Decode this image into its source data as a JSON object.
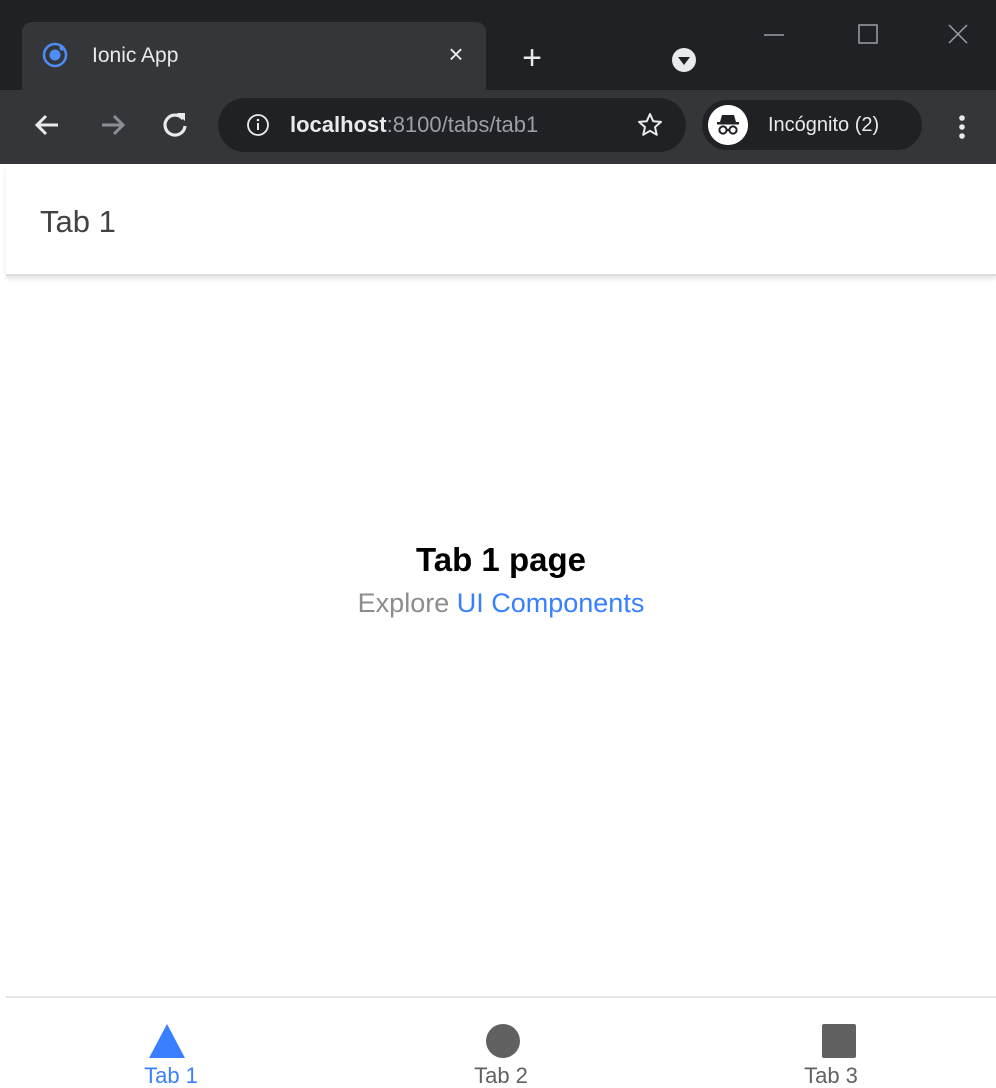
{
  "browser": {
    "tab_title": "Ionic App",
    "tab_close_glyph": "×",
    "new_tab_glyph": "+",
    "url_host": "localhost",
    "url_rest": ":8100/tabs/tab1",
    "incognito_label": "Incógnito (2)",
    "icons": [
      "ionic-favicon-icon",
      "close-icon",
      "plus-icon",
      "tab-search-icon",
      "minimize-icon",
      "maximize-icon",
      "window-close-icon",
      "back-arrow-icon",
      "forward-arrow-icon",
      "reload-icon",
      "info-icon",
      "star-icon",
      "incognito-icon",
      "kebab-menu-icon"
    ]
  },
  "app": {
    "toolbar_title": "Tab 1",
    "heading": "Tab 1 page",
    "subtitle_prefix": "Explore",
    "subtitle_link": "UI Components",
    "tabs": [
      {
        "label": "Tab 1",
        "icon": "triangle-icon",
        "active": true
      },
      {
        "label": "Tab 2",
        "icon": "ellipse-icon",
        "active": false
      },
      {
        "label": "Tab 3",
        "icon": "square-icon",
        "active": false
      }
    ]
  },
  "colors": {
    "primary": "#3880ff",
    "tab_inactive": "#616161",
    "browser_dark": "#202124",
    "browser_bar": "#35363a"
  }
}
